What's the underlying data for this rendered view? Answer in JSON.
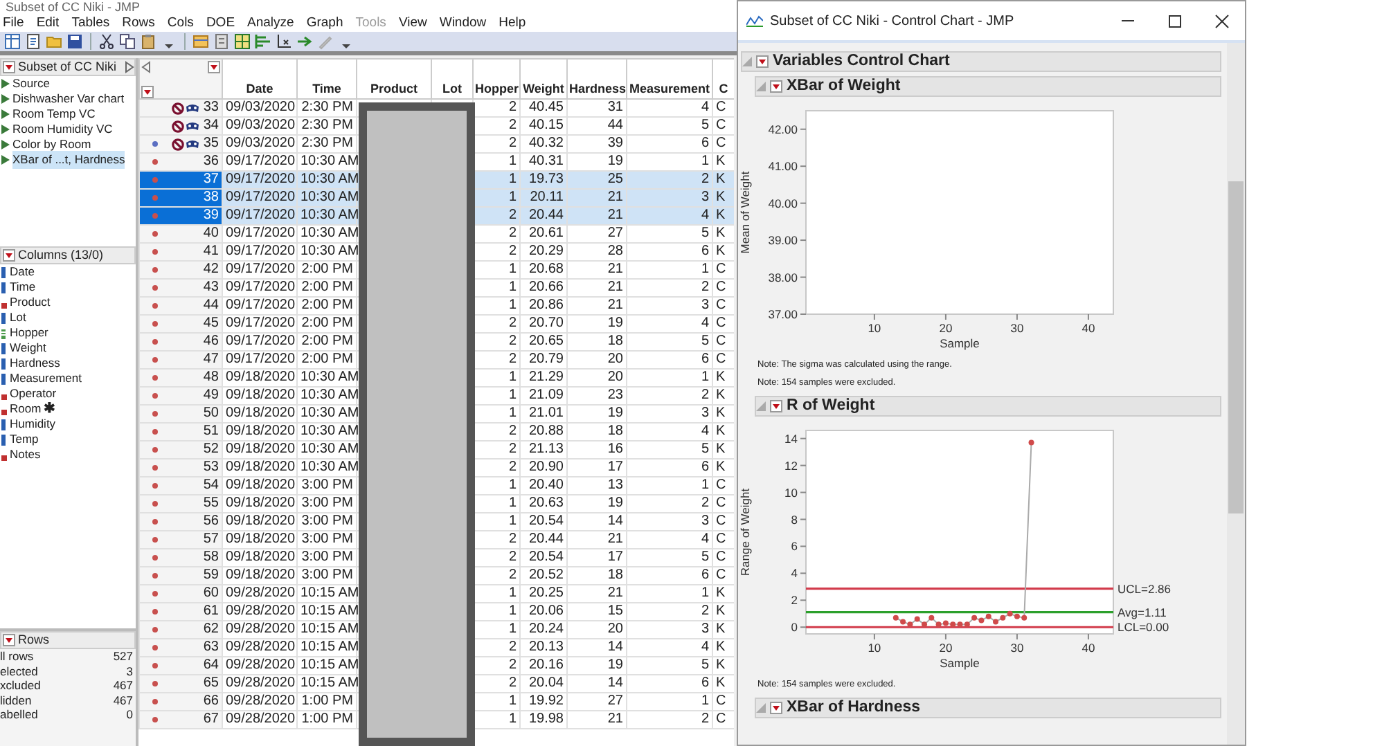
{
  "main_window": {
    "title": "Subset of CC Niki - JMP",
    "menu": [
      {
        "label": "File",
        "disabled": false
      },
      {
        "label": "Edit",
        "disabled": false
      },
      {
        "label": "Tables",
        "disabled": false
      },
      {
        "label": "Rows",
        "disabled": false
      },
      {
        "label": "Cols",
        "disabled": false
      },
      {
        "label": "DOE",
        "disabled": false
      },
      {
        "label": "Analyze",
        "disabled": false
      },
      {
        "label": "Graph",
        "disabled": false
      },
      {
        "label": "Tools",
        "disabled": true
      },
      {
        "label": "View",
        "disabled": false
      },
      {
        "label": "Window",
        "disabled": false
      },
      {
        "label": "Help",
        "disabled": false
      }
    ],
    "table_panel": {
      "title": "Subset of CC Niki",
      "items": [
        {
          "label": "Source",
          "selected": false
        },
        {
          "label": "Dishwasher Var chart",
          "selected": false
        },
        {
          "label": "Room Temp VC",
          "selected": false
        },
        {
          "label": "Room Humidity VC",
          "selected": false
        },
        {
          "label": "Color by Room",
          "selected": false
        },
        {
          "label": "XBar of ...t, Hardness",
          "selected": true
        }
      ]
    },
    "columns_panel": {
      "title": "Columns (13/0)",
      "items": [
        {
          "label": "Date",
          "kind": "continuous"
        },
        {
          "label": "Time",
          "kind": "continuous"
        },
        {
          "label": "Product",
          "kind": "nominal"
        },
        {
          "label": "Lot",
          "kind": "continuous"
        },
        {
          "label": "Hopper",
          "kind": "ordinal"
        },
        {
          "label": "Weight",
          "kind": "continuous"
        },
        {
          "label": "Hardness",
          "kind": "continuous"
        },
        {
          "label": "Measurement",
          "kind": "continuous"
        },
        {
          "label": "Operator",
          "kind": "nominal"
        },
        {
          "label": "Room",
          "kind": "nominal",
          "badge": "✱"
        },
        {
          "label": "Humidity",
          "kind": "continuous"
        },
        {
          "label": "Temp",
          "kind": "continuous"
        },
        {
          "label": "Notes",
          "kind": "nominal"
        }
      ]
    },
    "rows_panel": {
      "title": "Rows",
      "items": [
        {
          "label": "ll rows",
          "value": "527"
        },
        {
          "label": "elected",
          "value": "3"
        },
        {
          "label": "xcluded",
          "value": "467"
        },
        {
          "label": "lidden",
          "value": "467"
        },
        {
          "label": "abelled",
          "value": "0"
        }
      ]
    },
    "data_table": {
      "columns": [
        "Date",
        "Time",
        "Product",
        "Lot",
        "Hopper",
        "Weight",
        "Hardness",
        "Measurement",
        "C"
      ],
      "rows": [
        {
          "row": "33",
          "date": "09/03/2020",
          "time": "2:30 PM",
          "hopper": "2",
          "weight": "40.45",
          "hardness": "31",
          "measurement": "4",
          "column_10": "C",
          "selected": false,
          "excluded": true,
          "hidden": true
        },
        {
          "row": "34",
          "date": "09/03/2020",
          "time": "2:30 PM",
          "hopper": "2",
          "weight": "40.15",
          "hardness": "44",
          "measurement": "5",
          "column_10": "C",
          "selected": false,
          "excluded": true,
          "hidden": true
        },
        {
          "row": "35",
          "date": "09/03/2020",
          "time": "2:30 PM",
          "hopper": "2",
          "weight": "40.32",
          "hardness": "39",
          "measurement": "6",
          "column_10": "C",
          "selected": false,
          "excluded": true,
          "hidden": true,
          "color": "#5b6fc2"
        },
        {
          "row": "36",
          "date": "09/17/2020",
          "time": "10:30 AM",
          "hopper": "1",
          "weight": "40.31",
          "hardness": "19",
          "measurement": "1",
          "column_10": "K",
          "selected": false,
          "excluded": false,
          "hidden": false,
          "color": "#c8504e"
        },
        {
          "row": "37",
          "date": "09/17/2020",
          "time": "10:30 AM",
          "hopper": "1",
          "weight": "19.73",
          "hardness": "25",
          "measurement": "2",
          "column_10": "K",
          "selected": true,
          "excluded": false,
          "hidden": false,
          "color": "#c8504e"
        },
        {
          "row": "38",
          "date": "09/17/2020",
          "time": "10:30 AM",
          "hopper": "1",
          "weight": "20.11",
          "hardness": "21",
          "measurement": "3",
          "column_10": "K",
          "selected": true,
          "excluded": false,
          "hidden": false,
          "color": "#c8504e"
        },
        {
          "row": "39",
          "date": "09/17/2020",
          "time": "10:30 AM",
          "hopper": "2",
          "weight": "20.44",
          "hardness": "21",
          "measurement": "4",
          "column_10": "K",
          "selected": true,
          "excluded": false,
          "hidden": false,
          "color": "#c8504e"
        },
        {
          "row": "40",
          "date": "09/17/2020",
          "time": "10:30 AM",
          "hopper": "2",
          "weight": "20.61",
          "hardness": "27",
          "measurement": "5",
          "column_10": "K",
          "selected": false,
          "excluded": false,
          "hidden": false,
          "color": "#c8504e"
        },
        {
          "row": "41",
          "date": "09/17/2020",
          "time": "10:30 AM",
          "hopper": "2",
          "weight": "20.29",
          "hardness": "28",
          "measurement": "6",
          "column_10": "K",
          "selected": false,
          "excluded": false,
          "hidden": false,
          "color": "#c8504e"
        },
        {
          "row": "42",
          "date": "09/17/2020",
          "time": "2:00 PM",
          "hopper": "1",
          "weight": "20.68",
          "hardness": "21",
          "measurement": "1",
          "column_10": "C",
          "selected": false,
          "excluded": false,
          "hidden": false,
          "color": "#c8504e"
        },
        {
          "row": "43",
          "date": "09/17/2020",
          "time": "2:00 PM",
          "hopper": "1",
          "weight": "20.66",
          "hardness": "21",
          "measurement": "2",
          "column_10": "C",
          "selected": false,
          "excluded": false,
          "hidden": false,
          "color": "#c8504e"
        },
        {
          "row": "44",
          "date": "09/17/2020",
          "time": "2:00 PM",
          "hopper": "1",
          "weight": "20.86",
          "hardness": "21",
          "measurement": "3",
          "column_10": "C",
          "selected": false,
          "excluded": false,
          "hidden": false,
          "color": "#c8504e"
        },
        {
          "row": "45",
          "date": "09/17/2020",
          "time": "2:00 PM",
          "hopper": "2",
          "weight": "20.70",
          "hardness": "19",
          "measurement": "4",
          "column_10": "C",
          "selected": false,
          "excluded": false,
          "hidden": false,
          "color": "#c8504e"
        },
        {
          "row": "46",
          "date": "09/17/2020",
          "time": "2:00 PM",
          "hopper": "2",
          "weight": "20.65",
          "hardness": "18",
          "measurement": "5",
          "column_10": "C",
          "selected": false,
          "excluded": false,
          "hidden": false,
          "color": "#c8504e"
        },
        {
          "row": "47",
          "date": "09/17/2020",
          "time": "2:00 PM",
          "hopper": "2",
          "weight": "20.79",
          "hardness": "20",
          "measurement": "6",
          "column_10": "C",
          "selected": false,
          "excluded": false,
          "hidden": false,
          "color": "#c8504e"
        },
        {
          "row": "48",
          "date": "09/18/2020",
          "time": "10:30 AM",
          "hopper": "1",
          "weight": "21.29",
          "hardness": "20",
          "measurement": "1",
          "column_10": "K",
          "selected": false,
          "excluded": false,
          "hidden": false,
          "color": "#c8504e"
        },
        {
          "row": "49",
          "date": "09/18/2020",
          "time": "10:30 AM",
          "hopper": "1",
          "weight": "21.09",
          "hardness": "23",
          "measurement": "2",
          "column_10": "K",
          "selected": false,
          "excluded": false,
          "hidden": false,
          "color": "#c8504e"
        },
        {
          "row": "50",
          "date": "09/18/2020",
          "time": "10:30 AM",
          "hopper": "1",
          "weight": "21.01",
          "hardness": "19",
          "measurement": "3",
          "column_10": "K",
          "selected": false,
          "excluded": false,
          "hidden": false,
          "color": "#c8504e"
        },
        {
          "row": "51",
          "date": "09/18/2020",
          "time": "10:30 AM",
          "hopper": "2",
          "weight": "20.88",
          "hardness": "18",
          "measurement": "4",
          "column_10": "K",
          "selected": false,
          "excluded": false,
          "hidden": false,
          "color": "#c8504e"
        },
        {
          "row": "52",
          "date": "09/18/2020",
          "time": "10:30 AM",
          "hopper": "2",
          "weight": "21.13",
          "hardness": "16",
          "measurement": "5",
          "column_10": "K",
          "selected": false,
          "excluded": false,
          "hidden": false,
          "color": "#c8504e"
        },
        {
          "row": "53",
          "date": "09/18/2020",
          "time": "10:30 AM",
          "hopper": "2",
          "weight": "20.90",
          "hardness": "17",
          "measurement": "6",
          "column_10": "K",
          "selected": false,
          "excluded": false,
          "hidden": false,
          "color": "#c8504e"
        },
        {
          "row": "54",
          "date": "09/18/2020",
          "time": "3:00 PM",
          "hopper": "1",
          "weight": "20.40",
          "hardness": "13",
          "measurement": "1",
          "column_10": "C",
          "selected": false,
          "excluded": false,
          "hidden": false,
          "color": "#c8504e"
        },
        {
          "row": "55",
          "date": "09/18/2020",
          "time": "3:00 PM",
          "hopper": "1",
          "weight": "20.63",
          "hardness": "19",
          "measurement": "2",
          "column_10": "C",
          "selected": false,
          "excluded": false,
          "hidden": false,
          "color": "#c8504e"
        },
        {
          "row": "56",
          "date": "09/18/2020",
          "time": "3:00 PM",
          "hopper": "1",
          "weight": "20.54",
          "hardness": "14",
          "measurement": "3",
          "column_10": "C",
          "selected": false,
          "excluded": false,
          "hidden": false,
          "color": "#c8504e"
        },
        {
          "row": "57",
          "date": "09/18/2020",
          "time": "3:00 PM",
          "hopper": "2",
          "weight": "20.44",
          "hardness": "21",
          "measurement": "4",
          "column_10": "C",
          "selected": false,
          "excluded": false,
          "hidden": false,
          "color": "#c8504e"
        },
        {
          "row": "58",
          "date": "09/18/2020",
          "time": "3:00 PM",
          "hopper": "2",
          "weight": "20.54",
          "hardness": "17",
          "measurement": "5",
          "column_10": "C",
          "selected": false,
          "excluded": false,
          "hidden": false,
          "color": "#c8504e"
        },
        {
          "row": "59",
          "date": "09/18/2020",
          "time": "3:00 PM",
          "hopper": "2",
          "weight": "20.52",
          "hardness": "18",
          "measurement": "6",
          "column_10": "C",
          "selected": false,
          "excluded": false,
          "hidden": false,
          "color": "#c8504e"
        },
        {
          "row": "60",
          "date": "09/28/2020",
          "time": "10:15 AM",
          "hopper": "1",
          "weight": "20.25",
          "hardness": "21",
          "measurement": "1",
          "column_10": "K",
          "selected": false,
          "excluded": false,
          "hidden": false,
          "color": "#c8504e"
        },
        {
          "row": "61",
          "date": "09/28/2020",
          "time": "10:15 AM",
          "hopper": "1",
          "weight": "20.06",
          "hardness": "15",
          "measurement": "2",
          "column_10": "K",
          "selected": false,
          "excluded": false,
          "hidden": false,
          "color": "#c8504e"
        },
        {
          "row": "62",
          "date": "09/28/2020",
          "time": "10:15 AM",
          "hopper": "1",
          "weight": "20.24",
          "hardness": "20",
          "measurement": "3",
          "column_10": "K",
          "selected": false,
          "excluded": false,
          "hidden": false,
          "color": "#c8504e"
        },
        {
          "row": "63",
          "date": "09/28/2020",
          "time": "10:15 AM",
          "hopper": "2",
          "weight": "20.13",
          "hardness": "14",
          "measurement": "4",
          "column_10": "K",
          "selected": false,
          "excluded": false,
          "hidden": false,
          "color": "#c8504e"
        },
        {
          "row": "64",
          "date": "09/28/2020",
          "time": "10:15 AM",
          "hopper": "2",
          "weight": "20.16",
          "hardness": "19",
          "measurement": "5",
          "column_10": "K",
          "selected": false,
          "excluded": false,
          "hidden": false,
          "color": "#c8504e"
        },
        {
          "row": "65",
          "date": "09/28/2020",
          "time": "10:15 AM",
          "hopper": "2",
          "weight": "20.04",
          "hardness": "14",
          "measurement": "6",
          "column_10": "K",
          "selected": false,
          "excluded": false,
          "hidden": false,
          "color": "#c8504e"
        },
        {
          "row": "66",
          "date": "09/28/2020",
          "time": "1:00 PM",
          "hopper": "1",
          "weight": "19.92",
          "hardness": "27",
          "measurement": "1",
          "column_10": "C",
          "selected": false,
          "excluded": false,
          "hidden": false,
          "color": "#c8504e"
        },
        {
          "row": "67",
          "date": "09/28/2020",
          "time": "1:00 PM",
          "hopper": "1",
          "weight": "19.98",
          "hardness": "21",
          "measurement": "2",
          "column_10": "C",
          "selected": false,
          "excluded": false,
          "hidden": false,
          "color": "#c8504e"
        }
      ]
    }
  },
  "chart_window": {
    "title": "Subset of CC Niki - Control Chart - JMP",
    "outline": "Variables Control Chart",
    "reports": [
      {
        "title": "XBar of Weight",
        "chart_data": {
          "type": "line",
          "xlabel": "Sample",
          "ylabel": "Mean of Weight",
          "xlim": [
            0.4,
            43.5
          ],
          "ylim": [
            37,
            42.5
          ],
          "xticks": [
            10,
            20,
            30,
            40
          ],
          "yticks": [
            {
              "value": 37,
              "label": "37.00"
            },
            {
              "value": 38,
              "label": "38.00"
            },
            {
              "value": 39,
              "label": "39.00"
            },
            {
              "value": 40,
              "label": "40.00"
            },
            {
              "value": 41,
              "label": "41.00"
            },
            {
              "value": 42,
              "label": "42.00"
            }
          ]
        },
        "notes": [
          "Note: The sigma was calculated using the range.",
          "Note: 154 samples were excluded."
        ]
      },
      {
        "title": "R of Weight",
        "chart_data": {
          "type": "line",
          "xlabel": "Sample",
          "ylabel": "Range of Weight",
          "xlim": [
            0.4,
            43.5
          ],
          "ylim": [
            -0.5,
            14.6
          ],
          "xticks": [
            10,
            20,
            30,
            40
          ],
          "yticks": [
            0,
            2,
            4,
            6,
            8,
            10,
            12,
            14
          ],
          "x": [
            13,
            14,
            15,
            16,
            17,
            18,
            19,
            20,
            21,
            22,
            23,
            24,
            25,
            26,
            27,
            28,
            29,
            30,
            31,
            32
          ],
          "series": [
            {
              "color": "#d04a4a",
              "marker": "circle",
              "values": [
                0.7,
                0.4,
                0.2,
                0.6,
                0.2,
                0.7,
                0.2,
                0.3,
                0.2,
                0.2,
                0.2,
                0.7,
                0.5,
                0.8,
                0.4,
                0.7,
                1.0,
                0.8,
                0.7,
                13.7
              ]
            }
          ],
          "ref_lines": [
            {
              "axis": "y",
              "value": 2.86,
              "label": "UCL=2.86",
              "color": "#d23c4c"
            },
            {
              "axis": "y",
              "value": 1.11,
              "label": "Avg=1.11",
              "color": "#2ca02c"
            },
            {
              "axis": "y",
              "value": 0,
              "label": "LCL=0.00",
              "color": "#d23c4c"
            }
          ]
        },
        "notes": [
          "Note: 154 samples were excluded."
        ]
      },
      {
        "title": "XBar of Hardness"
      }
    ]
  }
}
